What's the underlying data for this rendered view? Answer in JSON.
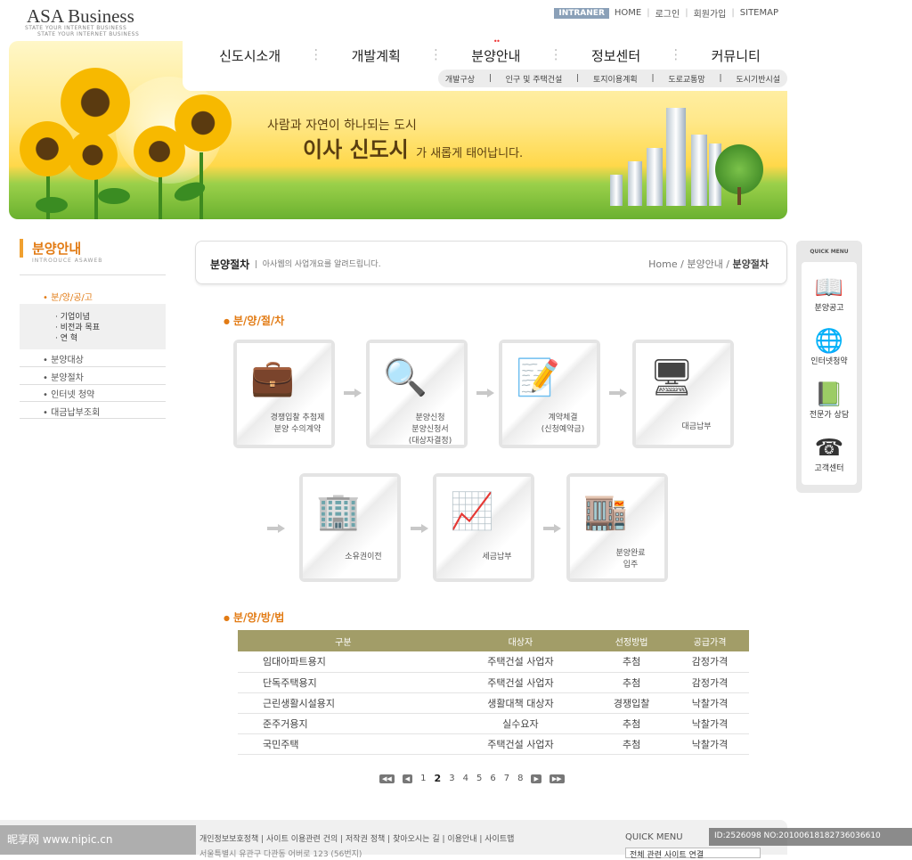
{
  "header": {
    "logo": "ASA Business",
    "logo_sub_1": "STATE YOUR INTERNET BUSINESS",
    "logo_sub_2": "STATE YOUR INTERNET BUSINESS",
    "util": {
      "intranet": "INTRANER",
      "home": "HOME",
      "login": "로그인",
      "join": "회원가입",
      "sitemap": "SITEMAP"
    },
    "gnb": [
      "신도시소개",
      "개발계획",
      "분양안내",
      "정보센터",
      "커뮤니티"
    ],
    "subnav": [
      "개발구상",
      "인구 및 주택건설",
      "토지이용계획",
      "도로교통망",
      "도시기반시설"
    ]
  },
  "banner": {
    "line1": "사람과 자연이 하나되는 도시",
    "line2_big": "이사 신도시",
    "line2_small": "가 새롭게 태어납니다."
  },
  "lnb": {
    "title": "분양안내",
    "subtitle": "INTRODUCE ASAWEB",
    "active": "분/양/공/고",
    "sub_items": [
      "기업이념",
      "비전과 목표",
      "연    혁"
    ],
    "items": [
      "분양대상",
      "분양절차",
      "인터넷 청약",
      "대금납부조회"
    ]
  },
  "content": {
    "title": "분양절차",
    "desc": "아사웹의 사업개요를 알려드립니다.",
    "breadcrumb": {
      "home": "Home",
      "mid": "분양안내",
      "current": "분양절차"
    },
    "section1": "분/양/절/차",
    "section2": "분/양/방/법",
    "steps": [
      {
        "icon": "briefcase-icon",
        "label": "경쟁입찰 추첨제\n분양 수의계약"
      },
      {
        "icon": "magnifier-map-icon",
        "label": "분양신청\n분양신청서\n(대상자결정)"
      },
      {
        "icon": "contract-pen-icon",
        "label": "계약체결\n(신청예약금)"
      },
      {
        "icon": "monitor-icon",
        "label": "대금납부"
      },
      {
        "icon": "building-folder-icon",
        "label": "소유권이전"
      },
      {
        "icon": "chart-arrows-icon",
        "label": "세금납부"
      },
      {
        "icon": "building-balloon-icon",
        "label": "분양완료\n입주"
      }
    ],
    "table": {
      "headers": [
        "구분",
        "대상자",
        "선정방법",
        "공급가격"
      ],
      "rows": [
        [
          "임대아파트용지",
          "주택건설 사업자",
          "추첨",
          "감정가격"
        ],
        [
          "단독주택용지",
          "주택건설 사업자",
          "추첨",
          "감정가격"
        ],
        [
          "근린생활시설용지",
          "생활대책 대상자",
          "경쟁입찰",
          "낙찰가격"
        ],
        [
          "준주거용지",
          "실수요자",
          "추첨",
          "낙찰가격"
        ],
        [
          "국민주택",
          "주택건설 사업자",
          "추첨",
          "낙찰가격"
        ]
      ]
    },
    "pager": {
      "pages": [
        "1",
        "2",
        "3",
        "4",
        "5",
        "6",
        "7",
        "8"
      ],
      "current": "2"
    }
  },
  "quick": {
    "title": "QUICK MENU",
    "items": [
      {
        "icon": "book-icon",
        "label": "분양공고"
      },
      {
        "icon": "globe-icon",
        "label": "인터넷청약"
      },
      {
        "icon": "open-book-icon",
        "label": "전문가 상담"
      },
      {
        "icon": "telephone-icon",
        "label": "고객센터"
      }
    ]
  },
  "footer": {
    "links": [
      "개인정보보호정책",
      "사이트 이용관련 건의",
      "저작권 정책",
      "찾아오시는 길",
      "이용안내",
      "사이트맵"
    ],
    "address": "서울특별시 유관구 다관동 어버로 123 (56번지)",
    "quick_label": "QUICK MENU",
    "select_value": "전체 관련 사이트 연결"
  },
  "watermark": {
    "left": "昵享网 www.nipic.cn",
    "right": "ID:2526098 NO:20100618182736036610"
  },
  "colors": {
    "accent": "#e27b14",
    "table_head": "#a29d68"
  }
}
